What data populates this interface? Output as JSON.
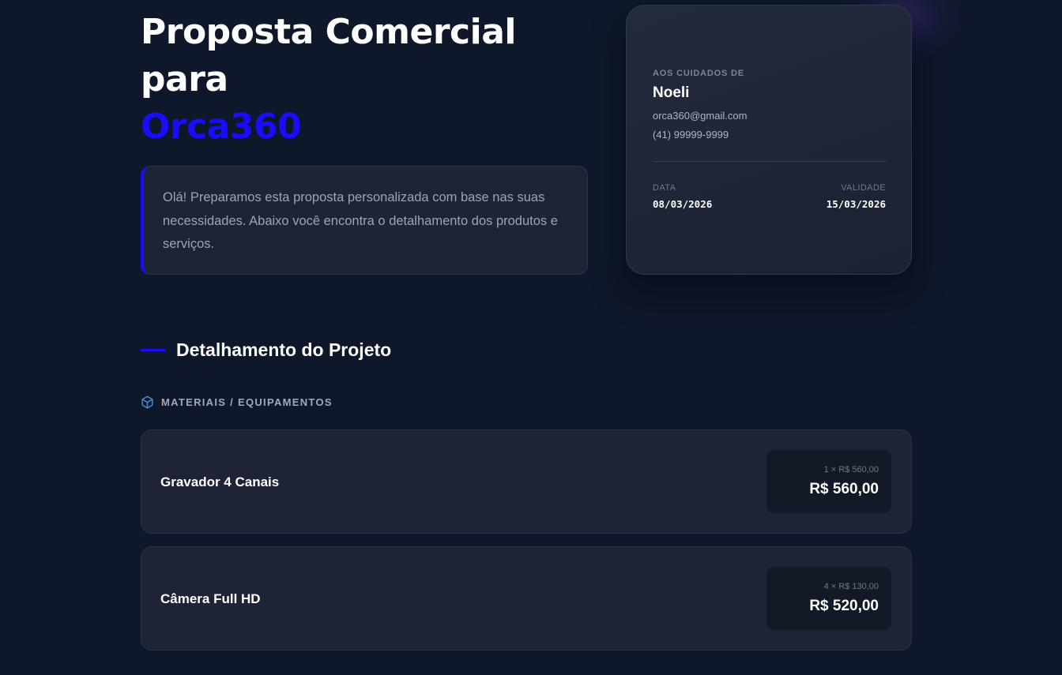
{
  "header": {
    "title_line1": "Proposta Comercial",
    "title_line2": "para",
    "client_name": "Orca360"
  },
  "intro": {
    "text": "Olá! Preparamos esta proposta personalizada com base nas suas necessidades. Abaixo você encontra o detalhamento dos produtos e serviços."
  },
  "client_card": {
    "label": "AOS CUIDADOS DE",
    "name": "Noeli",
    "email": "orca360@gmail.com",
    "phone": "(41) 99999-9999",
    "date_label": "DATA",
    "date_value": "08/03/2026",
    "validity_label": "VALIDADE",
    "validity_value": "15/03/2026"
  },
  "section": {
    "title": "Detalhamento do Projeto"
  },
  "category": {
    "label": "MATERIAIS / EQUIPAMENTOS",
    "icon": "box-icon"
  },
  "items": [
    {
      "name": "Gravador 4 Canais",
      "unit_line": "1 × R$ 560,00",
      "total": "R$ 560,00"
    },
    {
      "name": "Câmera Full HD",
      "unit_line": "4 × R$ 130,00",
      "total": "R$ 520,00"
    }
  ],
  "colors": {
    "background": "#0f172a",
    "accent": "#1a0dff",
    "surface": "#1e2436",
    "price_box": "#131a27",
    "category_icon": "#4f8fd6"
  }
}
